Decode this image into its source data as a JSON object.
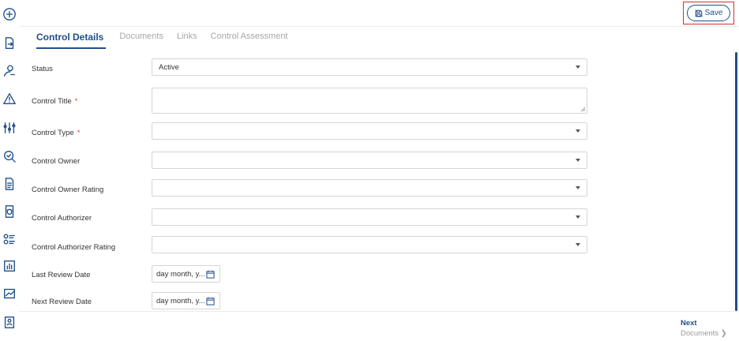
{
  "toolbar": {
    "save_label": "Save"
  },
  "tabs": [
    {
      "label": "Control Details",
      "active": true
    },
    {
      "label": "Documents",
      "active": false
    },
    {
      "label": "Links",
      "active": false
    },
    {
      "label": "Control Assessment",
      "active": false
    }
  ],
  "form": {
    "status": {
      "label": "Status",
      "value": "Active"
    },
    "control_title": {
      "label": "Control Title",
      "required_mark": "*",
      "value": ""
    },
    "control_type": {
      "label": "Control Type",
      "required_mark": "*",
      "value": ""
    },
    "control_owner": {
      "label": "Control Owner",
      "value": ""
    },
    "control_owner_rating": {
      "label": "Control Owner Rating",
      "value": ""
    },
    "control_authorizer": {
      "label": "Control Authorizer",
      "value": ""
    },
    "control_authorizer_rating": {
      "label": "Control Authorizer Rating",
      "value": ""
    },
    "last_review_date": {
      "label": "Last Review Date",
      "placeholder": "day month, y..."
    },
    "next_review_date": {
      "label": "Next Review Date",
      "placeholder": "day month, y..."
    }
  },
  "footer": {
    "next_label": "Next",
    "next_target": "Documents"
  },
  "sidebar_icons": [
    "add-circle-icon",
    "document-arrow-icon",
    "user-key-icon",
    "warning-icon",
    "sliders-icon",
    "search-check-icon",
    "document-icon",
    "shield-document-icon",
    "checklist-icon",
    "report-chart-icon",
    "trend-chart-icon",
    "profile-card-icon"
  ],
  "colors": {
    "accent": "#1f4f8a",
    "required": "#e53935",
    "highlight": "#d32f2f"
  }
}
